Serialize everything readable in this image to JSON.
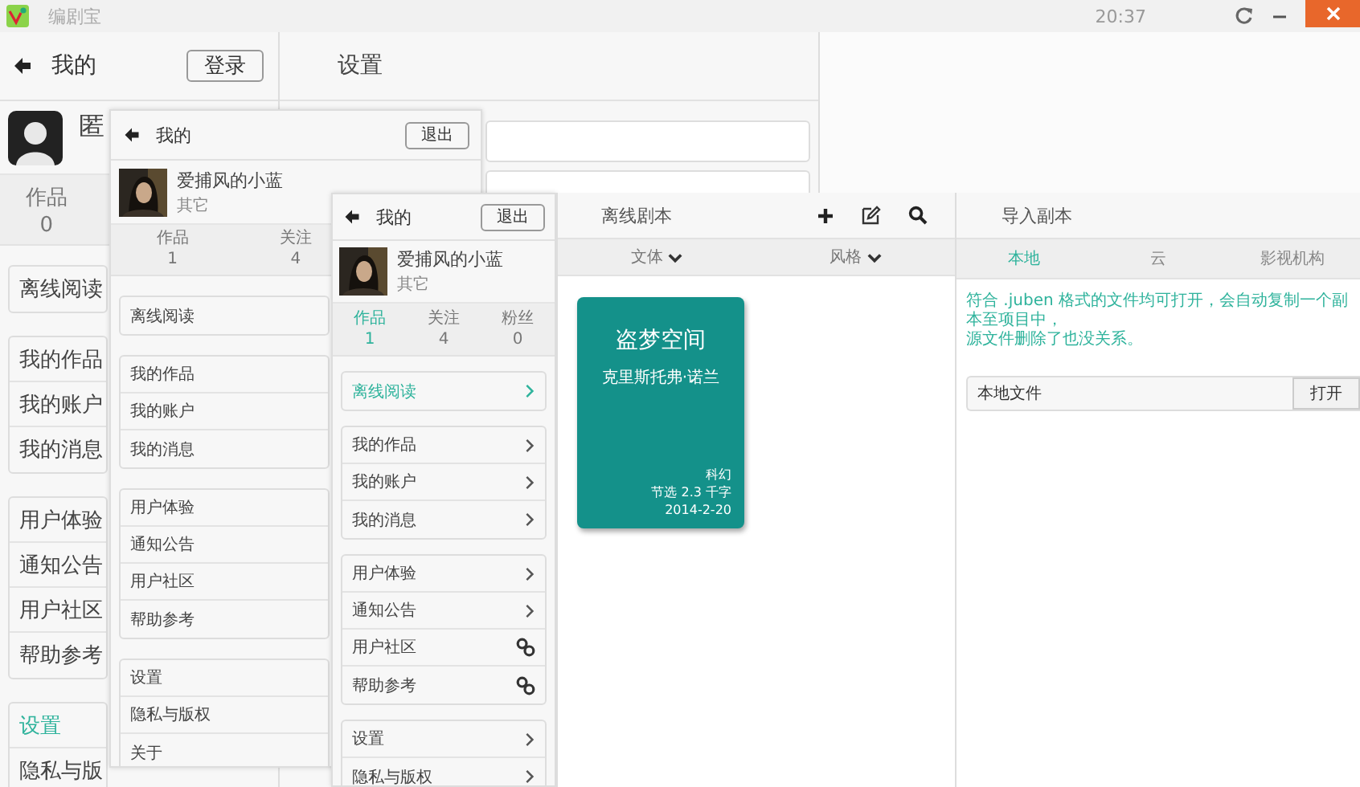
{
  "title_bar": {
    "app_name": "编剧宝",
    "time": "20:37"
  },
  "profile_panels": [
    {
      "title": "我的",
      "button": "登录",
      "avatar": {
        "kind": "icon"
      },
      "user_name": "匿",
      "stats": [
        {
          "label": "作品",
          "value": "0",
          "selected": false
        }
      ],
      "menu_groups": [
        [
          {
            "label": "离线阅读",
            "selected": false
          }
        ],
        [
          {
            "label": "我的作品",
            "selected": false
          },
          {
            "label": "我的账户",
            "selected": false
          },
          {
            "label": "我的消息",
            "selected": false
          }
        ],
        [
          {
            "label": "用户体验",
            "selected": false
          },
          {
            "label": "通知公告",
            "selected": false
          },
          {
            "label": "用户社区",
            "selected": false
          },
          {
            "label": "帮助参考",
            "selected": false
          }
        ],
        [
          {
            "label": "设置",
            "selected": true
          },
          {
            "label": "隐私与版",
            "selected": false
          }
        ]
      ]
    },
    {
      "title": "我的",
      "button": "退出",
      "avatar": {
        "kind": "picture"
      },
      "user_name": "爱捕风的小蓝",
      "user_note": "其它",
      "stats": [
        {
          "label": "作品",
          "value": "1",
          "selected": false
        },
        {
          "label": "关注",
          "value": "4",
          "selected": false
        }
      ],
      "menu_groups": [
        [
          {
            "label": "离线阅读",
            "selected": false
          }
        ],
        [
          {
            "label": "我的作品",
            "selected": false
          },
          {
            "label": "我的账户",
            "selected": false
          },
          {
            "label": "我的消息",
            "selected": false
          }
        ],
        [
          {
            "label": "用户体验",
            "selected": false
          },
          {
            "label": "通知公告",
            "selected": false
          },
          {
            "label": "用户社区",
            "selected": false
          },
          {
            "label": "帮助参考",
            "selected": false
          }
        ],
        [
          {
            "label": "设置",
            "selected": false
          },
          {
            "label": "隐私与版权",
            "selected": false
          },
          {
            "label": "关于",
            "selected": false
          }
        ]
      ]
    },
    {
      "title": "我的",
      "button": "退出",
      "avatar": {
        "kind": "picture"
      },
      "user_name": "爱捕风的小蓝",
      "user_note": "其它",
      "stats": [
        {
          "label": "作品",
          "value": "1",
          "selected": true
        },
        {
          "label": "关注",
          "value": "4",
          "selected": false
        },
        {
          "label": "粉丝",
          "value": "0",
          "selected": false
        }
      ],
      "menu_groups": [
        [
          {
            "label": "离线阅读",
            "selected": true,
            "kind": "chevron"
          }
        ],
        [
          {
            "label": "我的作品",
            "selected": false,
            "kind": "chevron"
          },
          {
            "label": "我的账户",
            "selected": false,
            "kind": "chevron"
          },
          {
            "label": "我的消息",
            "selected": false,
            "kind": "chevron"
          }
        ],
        [
          {
            "label": "用户体验",
            "selected": false,
            "kind": "chevron"
          },
          {
            "label": "通知公告",
            "selected": false,
            "kind": "chevron"
          },
          {
            "label": "用户社区",
            "selected": false,
            "kind": "link"
          },
          {
            "label": "帮助参考",
            "selected": false,
            "kind": "link"
          }
        ],
        [
          {
            "label": "设置",
            "selected": false,
            "kind": "chevron"
          },
          {
            "label": "隐私与版权",
            "selected": false,
            "kind": "chevron"
          }
        ]
      ]
    }
  ],
  "settings": {
    "title": "设置"
  },
  "library": {
    "title": "离线剧本",
    "filters": [
      "文体",
      "风格"
    ],
    "books": [
      {
        "title": "盗梦空间",
        "author": "克里斯托弗·诺兰",
        "genre": "科幻",
        "excerpt": "节选 2.3 千字",
        "date": "2014-2-20"
      }
    ]
  },
  "import": {
    "title": "导入副本",
    "tabs": [
      {
        "label": "本地",
        "selected": true
      },
      {
        "label": "云",
        "selected": false
      },
      {
        "label": "影视机构",
        "selected": false
      }
    ],
    "description_lines": [
      "符合 .juben 格式的文件均可打开，会自动复制一个副本至项目中，",
      "源文件删除了也没关系。"
    ],
    "file_row": {
      "label": "本地文件",
      "button": "打开"
    }
  }
}
